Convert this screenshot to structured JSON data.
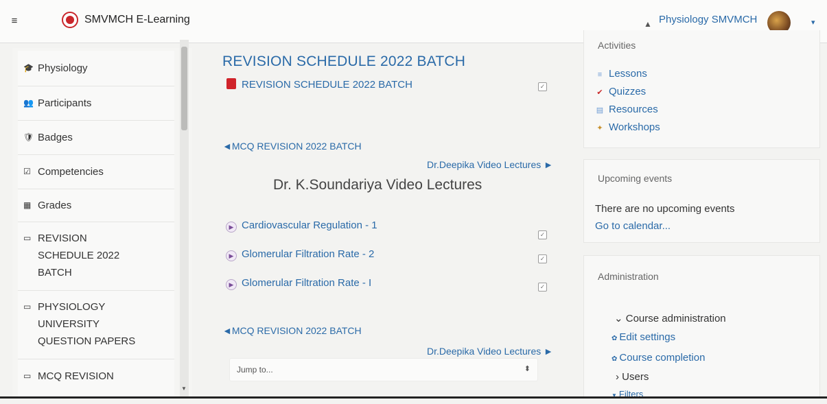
{
  "navbar": {
    "site_name": "SMVMCH E-Learning",
    "user_name": "Physiology SMVMCH",
    "hamburger_glyph": "≡",
    "bell_glyph": "▲",
    "caret_glyph": "▾"
  },
  "drawer": {
    "items": [
      {
        "icon": "mortarboard-icon",
        "glyph": "🎓",
        "label": "Physiology"
      },
      {
        "icon": "users-icon",
        "glyph": "👥",
        "label": "Participants"
      },
      {
        "icon": "shield-icon",
        "glyph": "🛡",
        "label": "Badges"
      },
      {
        "icon": "checkbox-icon",
        "glyph": "☑",
        "label": "Competencies"
      },
      {
        "icon": "table-icon",
        "glyph": "▦",
        "label": "Grades"
      },
      {
        "icon": "folder-icon",
        "glyph": "▭",
        "label_lines": [
          "REVISION",
          "SCHEDULE 2022",
          "BATCH"
        ]
      },
      {
        "icon": "folder-icon",
        "glyph": "▭",
        "label_lines": [
          "PHYSIOLOGY",
          "UNIVERSITY",
          "QUESTION PAPERS"
        ]
      },
      {
        "icon": "folder-icon",
        "glyph": "▭",
        "label": "MCQ REVISION"
      }
    ]
  },
  "main": {
    "section_title": "REVISION SCHEDULE 2022 BATCH",
    "pdf_activity": "REVISION SCHEDULE 2022 BATCH",
    "nav_prev_1": "◄MCQ REVISION 2022 BATCH",
    "nav_next_1": "Dr.Deepika Video Lectures ►",
    "heading": "Dr. K.Soundariya Video Lectures",
    "videos": [
      "Cardiovascular Regulation - 1",
      "Glomerular Filtration Rate - 2",
      "Glomerular Filtration Rate - I"
    ],
    "nav_prev_2": "◄MCQ REVISION 2022 BATCH",
    "nav_next_2": "Dr.Deepika Video Lectures ►",
    "jump_value": "Jump to...",
    "jump_arrow": "⬍",
    "check_glyph": "✓"
  },
  "activities_block": {
    "title": "Activities",
    "links": [
      {
        "icon": "lessons-icon",
        "glyph": "≡",
        "color": "#6d9bd4",
        "label": "Lessons"
      },
      {
        "icon": "quiz-checkmark-icon",
        "glyph": "✔",
        "color": "#c92a2a",
        "label": "Quizzes"
      },
      {
        "icon": "resource-file-icon",
        "glyph": "▤",
        "color": "#6d9bd4",
        "label": "Resources"
      },
      {
        "icon": "workshop-icon",
        "glyph": "✦",
        "color": "#c7902c",
        "label": "Workshops"
      }
    ]
  },
  "events_block": {
    "title": "Upcoming events",
    "empty_text": "There are no upcoming events",
    "calendar_link": "Go to calendar..."
  },
  "admin_block": {
    "title": "Administration",
    "course_admin": "⌄ Course administration",
    "edit_settings": "Edit settings",
    "course_completion": "Course completion",
    "users": "› Users",
    "filters": "Filters",
    "gear_glyph": "✿",
    "filter_glyph": "▼"
  }
}
